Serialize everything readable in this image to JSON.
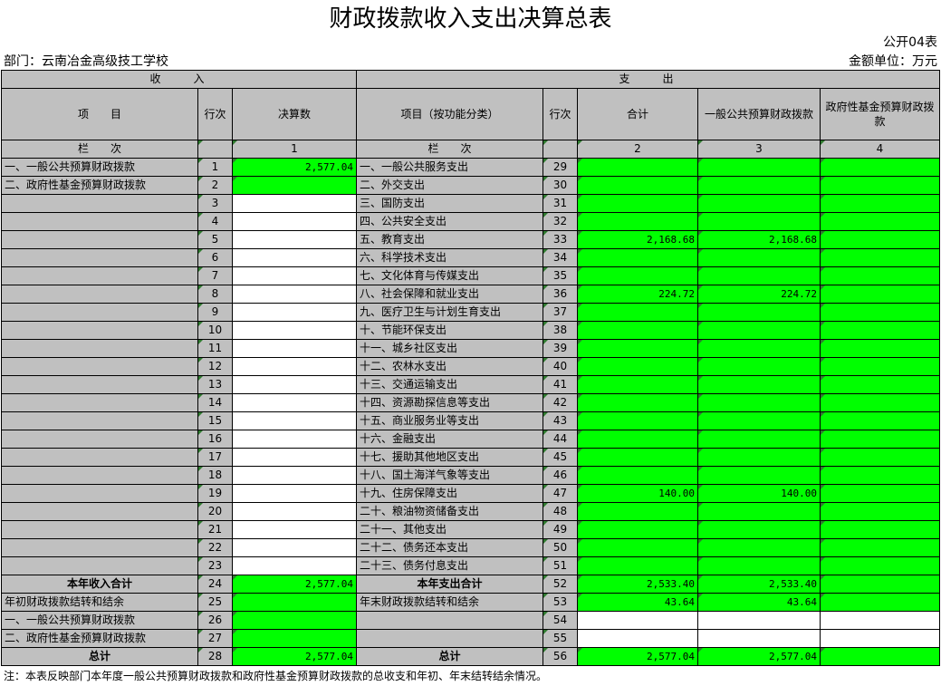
{
  "title": "财政拨款收入支出决算总表",
  "form_code": "公开04表",
  "department": "部门：云南冶金高级技工学校",
  "unit": "金额单位：万元",
  "sections": {
    "income": "收　　入",
    "expense": "支　　出"
  },
  "headers": {
    "item": "项　　目",
    "row_no": "行次",
    "amount": "决算数",
    "expense_item": "项目（按功能分类）",
    "row_no2": "行次",
    "total": "合计",
    "general": "一般公共预算财政拨款",
    "fund": "政府性基金预算财政拨款"
  },
  "lan_row": {
    "label": "栏　　次",
    "c1": "1",
    "label2": "栏　　次",
    "c2": "2",
    "c3": "3",
    "c4": "4"
  },
  "rows": [
    {
      "inc": "一、一般公共预算财政拨款",
      "r": "1",
      "amt": "2,577.04",
      "exp": "一、一般公共服务支出",
      "r2": "29",
      "t": "",
      "g": "",
      "f": ""
    },
    {
      "inc": "二、政府性基金预算财政拨款",
      "r": "2",
      "amt": "",
      "exp": "二、外交支出",
      "r2": "30",
      "t": "",
      "g": "",
      "f": ""
    },
    {
      "inc": "",
      "r": "3",
      "amt": "",
      "exp": "三、国防支出",
      "r2": "31",
      "t": "",
      "g": "",
      "f": ""
    },
    {
      "inc": "",
      "r": "4",
      "amt": "",
      "exp": "四、公共安全支出",
      "r2": "32",
      "t": "",
      "g": "",
      "f": ""
    },
    {
      "inc": "",
      "r": "5",
      "amt": "",
      "exp": "五、教育支出",
      "r2": "33",
      "t": "2,168.68",
      "g": "2,168.68",
      "f": ""
    },
    {
      "inc": "",
      "r": "6",
      "amt": "",
      "exp": "六、科学技术支出",
      "r2": "34",
      "t": "",
      "g": "",
      "f": ""
    },
    {
      "inc": "",
      "r": "7",
      "amt": "",
      "exp": "七、文化体育与传媒支出",
      "r2": "35",
      "t": "",
      "g": "",
      "f": ""
    },
    {
      "inc": "",
      "r": "8",
      "amt": "",
      "exp": "八、社会保障和就业支出",
      "r2": "36",
      "t": "224.72",
      "g": "224.72",
      "f": ""
    },
    {
      "inc": "",
      "r": "9",
      "amt": "",
      "exp": "九、医疗卫生与计划生育支出",
      "r2": "37",
      "t": "",
      "g": "",
      "f": ""
    },
    {
      "inc": "",
      "r": "10",
      "amt": "",
      "exp": "十、节能环保支出",
      "r2": "38",
      "t": "",
      "g": "",
      "f": ""
    },
    {
      "inc": "",
      "r": "11",
      "amt": "",
      "exp": "十一、城乡社区支出",
      "r2": "39",
      "t": "",
      "g": "",
      "f": ""
    },
    {
      "inc": "",
      "r": "12",
      "amt": "",
      "exp": "十二、农林水支出",
      "r2": "40",
      "t": "",
      "g": "",
      "f": ""
    },
    {
      "inc": "",
      "r": "13",
      "amt": "",
      "exp": "十三、交通运输支出",
      "r2": "41",
      "t": "",
      "g": "",
      "f": ""
    },
    {
      "inc": "",
      "r": "14",
      "amt": "",
      "exp": "十四、资源勘探信息等支出",
      "r2": "42",
      "t": "",
      "g": "",
      "f": ""
    },
    {
      "inc": "",
      "r": "15",
      "amt": "",
      "exp": "十五、商业服务业等支出",
      "r2": "43",
      "t": "",
      "g": "",
      "f": ""
    },
    {
      "inc": "",
      "r": "16",
      "amt": "",
      "exp": "十六、金融支出",
      "r2": "44",
      "t": "",
      "g": "",
      "f": ""
    },
    {
      "inc": "",
      "r": "17",
      "amt": "",
      "exp": "十七、援助其他地区支出",
      "r2": "45",
      "t": "",
      "g": "",
      "f": ""
    },
    {
      "inc": "",
      "r": "18",
      "amt": "",
      "exp": "十八、国土海洋气象等支出",
      "r2": "46",
      "t": "",
      "g": "",
      "f": ""
    },
    {
      "inc": "",
      "r": "19",
      "amt": "",
      "exp": "十九、住房保障支出",
      "r2": "47",
      "t": "140.00",
      "g": "140.00",
      "f": ""
    },
    {
      "inc": "",
      "r": "20",
      "amt": "",
      "exp": "二十、粮油物资储备支出",
      "r2": "48",
      "t": "",
      "g": "",
      "f": ""
    },
    {
      "inc": "",
      "r": "21",
      "amt": "",
      "exp": "二十一、其他支出",
      "r2": "49",
      "t": "",
      "g": "",
      "f": ""
    },
    {
      "inc": "",
      "r": "22",
      "amt": "",
      "exp": "二十二、债务还本支出",
      "r2": "50",
      "t": "",
      "g": "",
      "f": ""
    },
    {
      "inc": "",
      "r": "23",
      "amt": "",
      "exp": "二十三、债务付息支出",
      "r2": "51",
      "t": "",
      "g": "",
      "f": ""
    }
  ],
  "summary": {
    "income_total": {
      "label": "本年收入合计",
      "r": "24",
      "amt": "2,577.04"
    },
    "expense_total": {
      "label": "本年支出合计",
      "r": "52",
      "t": "2,533.40",
      "g": "2,533.40",
      "f": ""
    },
    "begin_balance": {
      "label": "年初财政拨款结转和结余",
      "r": "25",
      "amt": ""
    },
    "end_balance": {
      "label": "年末财政拨款结转和结余",
      "r": "53",
      "t": "43.64",
      "g": "43.64",
      "f": ""
    },
    "begin_general": {
      "label": "一、一般公共预算财政拨款",
      "r": "26",
      "amt": ""
    },
    "r54": "54",
    "begin_fund": {
      "label": "二、政府性基金预算财政拨款",
      "r": "27",
      "amt": ""
    },
    "r55": "55",
    "grand_income": {
      "label": "总计",
      "r": "28",
      "amt": "2,577.04"
    },
    "grand_expense": {
      "label": "总计",
      "r": "56",
      "t": "2,577.04",
      "g": "2,577.04",
      "f": ""
    }
  },
  "footnote": "注：本表反映部门本年度一般公共预算财政拨款和政府性基金预算财政拨款的总收支和年初、年末结转结余情况。",
  "colors": {
    "header_gray": "#c0c0c0",
    "data_green": "#00ff00",
    "marker_green": "#2f7a2f"
  }
}
